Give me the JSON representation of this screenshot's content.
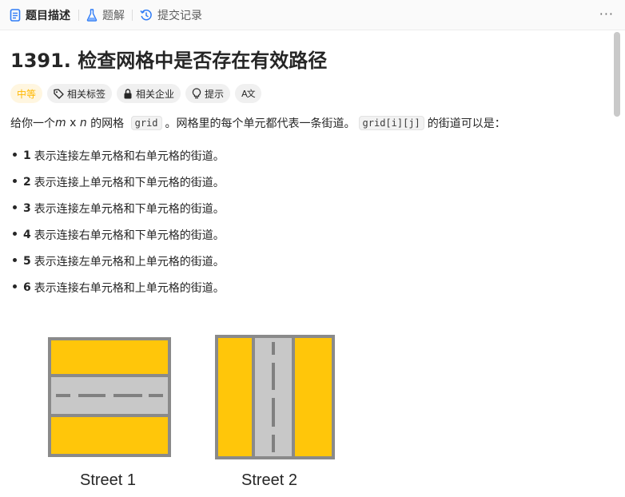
{
  "tabs": [
    {
      "label": "题目描述",
      "icon": "description-icon"
    },
    {
      "label": "题解",
      "icon": "flask-icon"
    },
    {
      "label": "提交记录",
      "icon": "history-icon"
    }
  ],
  "more_label": "···",
  "problem": {
    "title": "1391. 检查网格中是否存在有效路径",
    "difficulty": "中等",
    "tags": [
      {
        "label": "相关标签",
        "icon": "tag-icon"
      },
      {
        "label": "相关企业",
        "icon": "lock-icon"
      },
      {
        "label": "提示",
        "icon": "lightbulb-icon"
      },
      {
        "label": "",
        "icon": "translate-icon",
        "glyph": "A文"
      }
    ],
    "description": {
      "p1": "给你一个 ",
      "m": "m",
      "x": " x ",
      "n": "n",
      "p2": " 的网格 ",
      "code1": "grid",
      "p3": "。网格里的每个单元都代表一条街道。",
      "code2": "grid[i][j]",
      "p4": " 的街道可以是："
    },
    "rules": [
      {
        "num": "1",
        "text": "表示连接左单元格和右单元格的街道。"
      },
      {
        "num": "2",
        "text": "表示连接上单元格和下单元格的街道。"
      },
      {
        "num": "3",
        "text": "表示连接左单元格和下单元格的街道。"
      },
      {
        "num": "4",
        "text": "表示连接右单元格和下单元格的街道。"
      },
      {
        "num": "5",
        "text": "表示连接左单元格和上单元格的街道。"
      },
      {
        "num": "6",
        "text": "表示连接右单元格和上单元格的街道。"
      }
    ],
    "figures": [
      {
        "label": "Street 1",
        "orientation": "horizontal"
      },
      {
        "label": "Street 2",
        "orientation": "vertical"
      }
    ]
  },
  "colors": {
    "accent_yellow": "#ffc60a",
    "road_gray": "#c8c8c8",
    "border_gray": "#8a8a8a",
    "dash_gray": "#808080",
    "difficulty": "#ffb800"
  }
}
